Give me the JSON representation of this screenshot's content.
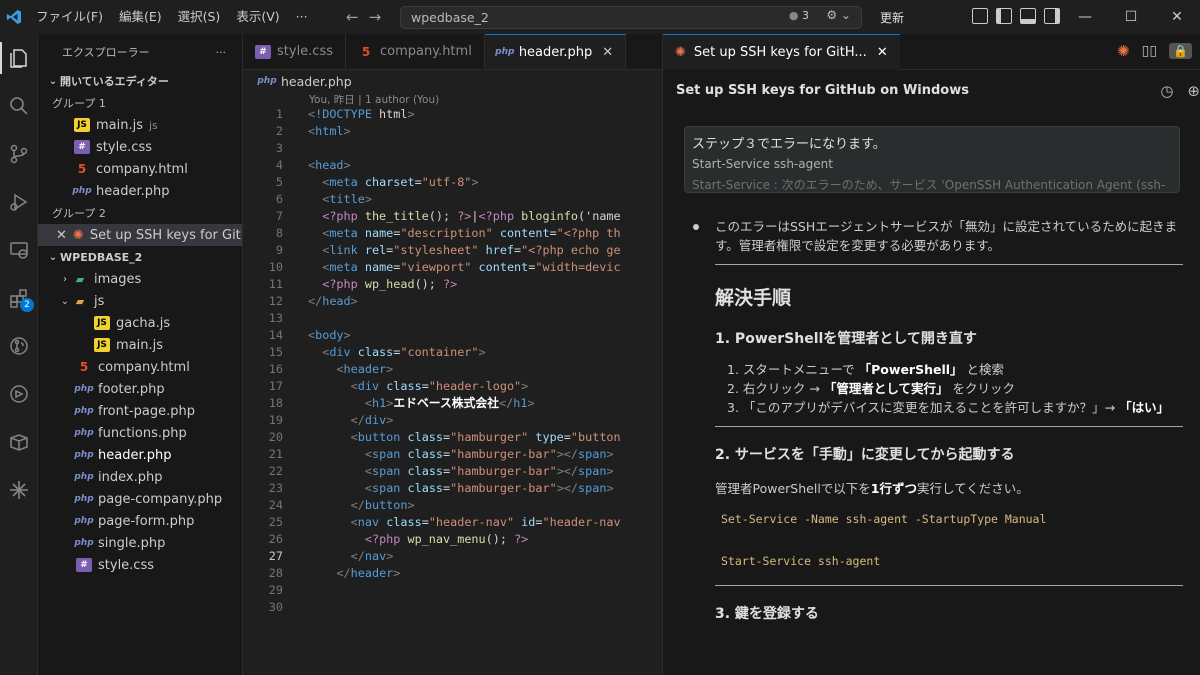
{
  "titlebar": {
    "menu": [
      "ファイル(F)",
      "編集(E)",
      "選択(S)",
      "表示(V)",
      "···"
    ],
    "search_value": "wpedbase_2",
    "badge_count": "3",
    "update_label": "更新"
  },
  "sidebar": {
    "title": "エクスプローラー",
    "more": "···",
    "open_editors_label": "開いているエディター",
    "group1_label": "グループ 1",
    "group1_files": [
      {
        "name": "main.js",
        "sub": "js",
        "type": "js"
      },
      {
        "name": "style.css",
        "type": "css"
      },
      {
        "name": "company.html",
        "type": "html"
      },
      {
        "name": "header.php",
        "type": "php"
      }
    ],
    "group2_label": "グループ 2",
    "group2_files": [
      {
        "name": "Set up SSH keys for Git...",
        "type": "chat"
      }
    ],
    "project_label": "WPEDBASE_2",
    "tree": [
      {
        "name": "images",
        "kind": "folder"
      },
      {
        "name": "js",
        "kind": "folder-open"
      },
      {
        "name": "gacha.js",
        "kind": "js"
      },
      {
        "name": "main.js",
        "kind": "js"
      },
      {
        "name": "company.html",
        "kind": "html"
      },
      {
        "name": "footer.php",
        "kind": "php"
      },
      {
        "name": "front-page.php",
        "kind": "php"
      },
      {
        "name": "functions.php",
        "kind": "php"
      },
      {
        "name": "header.php",
        "kind": "php"
      },
      {
        "name": "index.php",
        "kind": "php"
      },
      {
        "name": "page-company.php",
        "kind": "php"
      },
      {
        "name": "page-form.php",
        "kind": "php"
      },
      {
        "name": "single.php",
        "kind": "php"
      },
      {
        "name": "style.css",
        "kind": "css"
      }
    ]
  },
  "editor": {
    "tabs": [
      {
        "label": "style.css",
        "type": "css"
      },
      {
        "label": "company.html",
        "type": "html"
      },
      {
        "label": "header.php",
        "type": "php"
      }
    ],
    "breadcrumb": "header.php",
    "blame": "You, 昨日 | 1 author (You)",
    "lines": [
      "<!DOCTYPE html>",
      "<html>",
      "",
      "<head>",
      "  <meta charset=\"utf-8\">",
      "  <title>",
      "  <?php the_title(); ?>|<?php bloginfo('name",
      "  <meta name=\"description\" content=\"<?php th",
      "  <link rel=\"stylesheet\" href=\"<?php echo ge",
      "  <meta name=\"viewport\" content=\"width=devic",
      "  <?php wp_head(); ?>",
      "</head>",
      "",
      "<body>",
      "  <div class=\"container\">",
      "    <header>",
      "      <div class=\"header-logo\">",
      "        <h1>エドベース株式会社</h1>",
      "      </div>",
      "      <button class=\"hamburger\" type=\"button",
      "        <span class=\"hamburger-bar\"></span>",
      "        <span class=\"hamburger-bar\"></span>",
      "        <span class=\"hamburger-bar\"></span>",
      "      </button>",
      "      <nav class=\"header-nav\" id=\"header-nav",
      "        <?php wp_nav_menu(); ?>",
      "      </nav>",
      "    </header>",
      "",
      ""
    ],
    "current_line": 27
  },
  "chat": {
    "tab_label": "Set up SSH keys for GitH...",
    "title": "Set up SSH keys for GitHub on Windows",
    "user_msg_1": "ステップ３でエラーになります。",
    "user_msg_2": "Start-Service ssh-agent",
    "user_msg_3": "Start-Service : 次のエラーのため、サービス 'OpenSSH Authentication Agent (ssh-",
    "answer_intro": "このエラーはSSHエージェントサービスが「無効」に設定されているために起きます。管理者権限で設定を変更する必要があります。",
    "h_solution": "解決手順",
    "step1_title": "1. PowerShellを管理者として開き直す",
    "step1_items": [
      [
        "スタートメニューで ",
        "「PowerShell」",
        " と検索"
      ],
      [
        "右クリック → ",
        "「管理者として実行」",
        " をクリック"
      ],
      [
        "「このアプリがデバイスに変更を加えることを許可しますか？」→ ",
        "「はい」",
        ""
      ]
    ],
    "step2_title": "2. サービスを「手動」に変更してから起動する",
    "step2_text_a": "管理者PowerShellで以下を",
    "step2_text_b": "1行ずつ",
    "step2_text_c": "実行してください。",
    "code1": "Set-Service -Name ssh-agent -StartupType Manual",
    "code2": "Start-Service ssh-agent",
    "step3_title": "3. 鍵を登録する"
  }
}
